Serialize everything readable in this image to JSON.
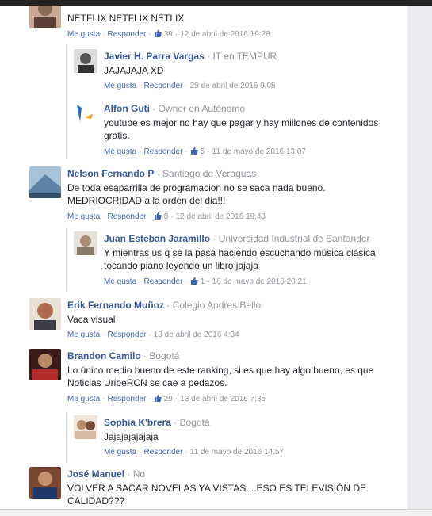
{
  "comments": [
    {
      "text": "NETFLIX NETFLIX NETLIX",
      "actions": {
        "like": "Me gusta",
        "reply": "Responder",
        "likes": "39",
        "time": "12 de abril de 2016 19:28"
      },
      "avatar_color": "#8c6a5a"
    },
    {
      "name": "Javier H. Parra Vargas",
      "subtitle": "IT en TEMPUR",
      "text": "JAJAJAJA XD",
      "actions": {
        "like": "Me gusta",
        "reply": "Responder",
        "time": "29 de abril de 2016 9:05"
      },
      "avatar_color": "#6b6b6b"
    },
    {
      "name": "Alfon Guti",
      "subtitle": "Owner en Autónomo",
      "text": "youtube es mejor no hay que pagar y hay millones de contenidos gratis.",
      "actions": {
        "like": "Me gusta",
        "reply": "Responder",
        "likes": "5",
        "time": "11 de mayo de 2016 13:07"
      },
      "avatar_color": "#e8eef5"
    },
    {
      "name": "Nelson Fernando P",
      "subtitle": "Santiago de Veraguas",
      "text": "De toda esaparrilla de programacion no se saca nada bueno. MEDRIOCRIDAD a la orden del dia!!!",
      "actions": {
        "like": "Me gusta",
        "reply": "Responder",
        "likes": "8",
        "time": "12 de abril de 2016 19:43"
      },
      "avatar_color": "#6f95b5"
    },
    {
      "name": "Juan Esteban Jaramillo",
      "subtitle": "Universidad Industrial de Santander",
      "text": "Y mientras us q se la pasa haciendo escuchando música clásica tocando piano leyendo un libro jajaja",
      "actions": {
        "like": "Me gusta",
        "reply": "Responder",
        "likes": "1",
        "time": "16 de mayo de 2016 20:21"
      },
      "avatar_color": "#c9c1b8"
    },
    {
      "name": "Erik Fernando Muñoz",
      "subtitle": "Colegio Andres Bello",
      "text": "Vaca visual",
      "actions": {
        "like": "Me gusta",
        "reply": "Responder",
        "time": "13 de abril de 2016 4:34"
      },
      "avatar_color": "#b06a4f"
    },
    {
      "name": "Brandon Camilo",
      "subtitle": "Bogotá",
      "text": "Lo único medio bueno de este ranking, si es que hay algo bueno, es que Noticias UribeRCN se cae a pedazos.",
      "actions": {
        "like": "Me gusta",
        "reply": "Responder",
        "likes": "29",
        "time": "13 de abril de 2016 7:35"
      },
      "avatar_color": "#7a2020"
    },
    {
      "name": "Sophia K'brera",
      "subtitle": "Bogotá",
      "text": "Jajajajajajaja",
      "actions": {
        "like": "Me gusta",
        "reply": "Responder",
        "time": "11 de mayo de 2016 14:57"
      },
      "avatar_color": "#b98b6f"
    },
    {
      "name": "José Manuel",
      "subtitle": "No",
      "text": "VOLVER A SACAR NOVELAS YA VISTAS....ESO ES TELEVISIÓN DE CALIDAD???",
      "actions": {},
      "avatar_color": "#8a3a2a"
    }
  ],
  "colors": {
    "name": "#365899",
    "link": "#4267b2",
    "meta": "#90949c",
    "text": "#1d2129"
  }
}
